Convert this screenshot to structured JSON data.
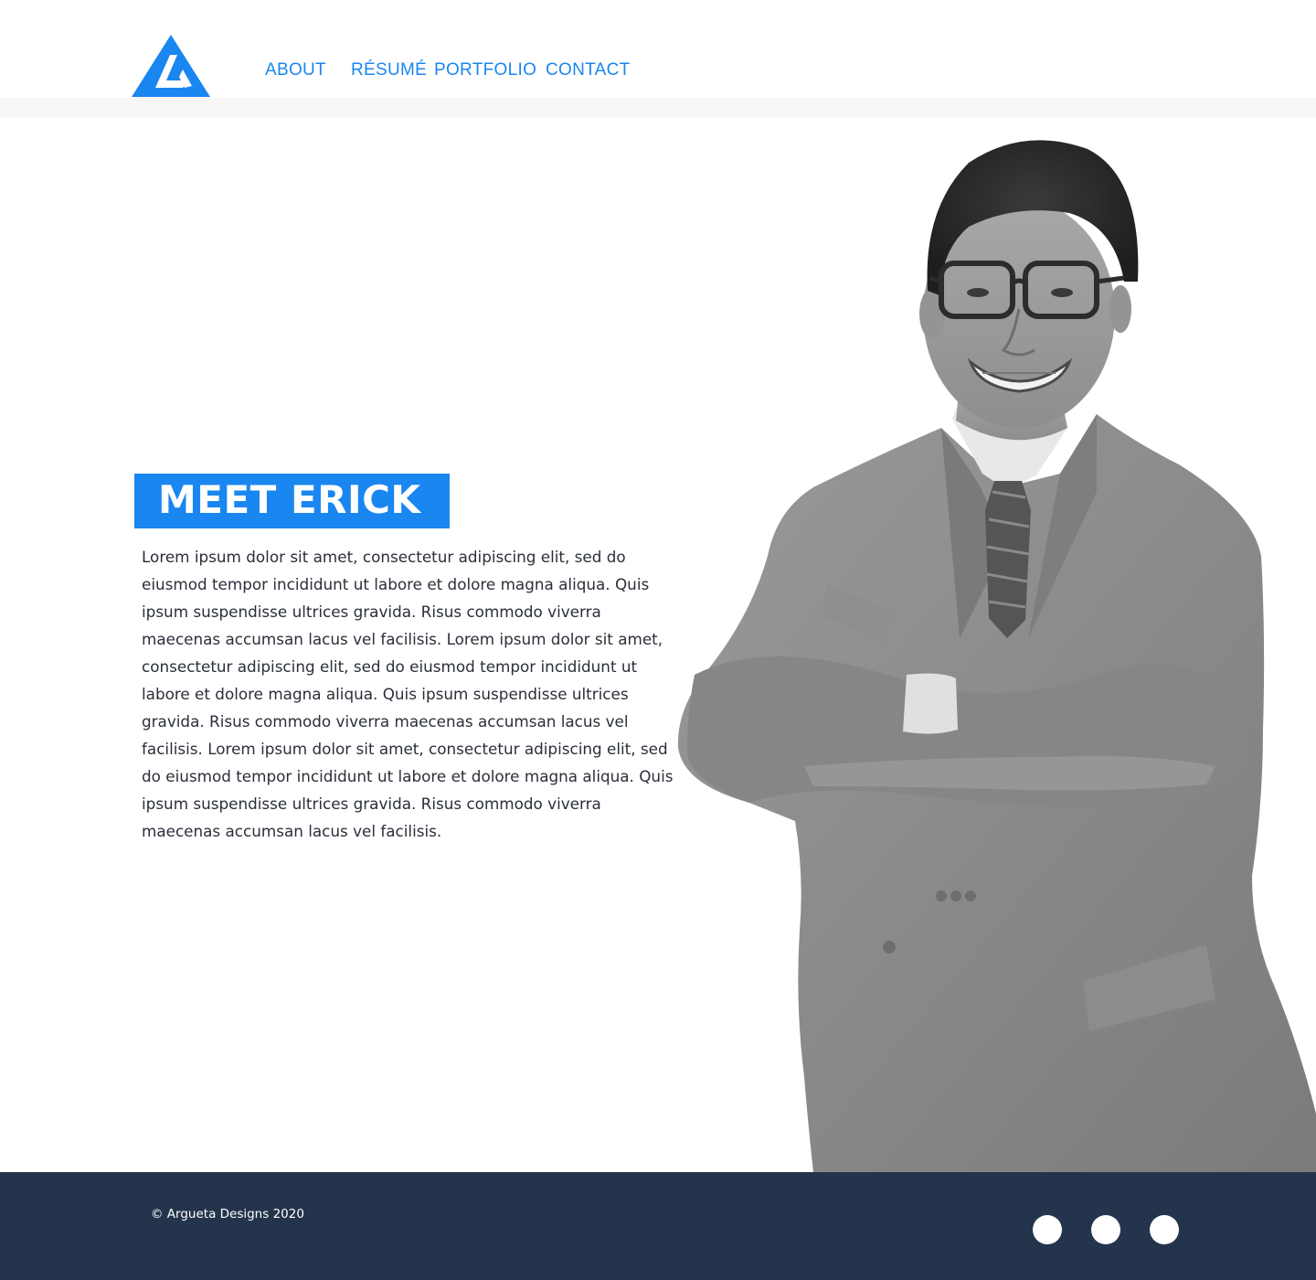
{
  "brand": {
    "accent": "#1a86f0",
    "footer_bg": "#24344d",
    "logo_icon": "triangle-l-logo-icon"
  },
  "nav": {
    "items": [
      {
        "label": "ABOUT"
      },
      {
        "label": "RÉSUMÉ"
      },
      {
        "label": "PORTFOLIO"
      },
      {
        "label": "CONTACT"
      }
    ]
  },
  "hero": {
    "title": "MEET ERICK",
    "bio": "Lorem ipsum dolor sit amet, consectetur adipiscing elit, sed do eiusmod tempor incididunt ut labore et dolore magna aliqua. Quis ipsum suspendisse ultrices gravida. Risus commodo viverra maecenas accumsan lacus vel facilisis. Lorem ipsum dolor sit amet, consectetur adipiscing elit, sed do eiusmod tempor incididunt ut labore et dolore magna aliqua. Quis ipsum suspendisse ultrices gravida. Risus commodo viverra maecenas accumsan lacus vel facilisis. Lorem ipsum dolor sit amet, consectetur adipiscing elit, sed do eiusmod tempor incididunt ut labore et dolore magna aliqua. Quis ipsum suspendisse ultrices gravida. Risus commodo viverra maecenas accumsan lacus vel facilisis.",
    "photo": "portrait-photo"
  },
  "footer": {
    "copyright": "© Argueta Designs 2020",
    "social_icons": [
      "social-icon",
      "social-icon",
      "social-icon"
    ]
  }
}
